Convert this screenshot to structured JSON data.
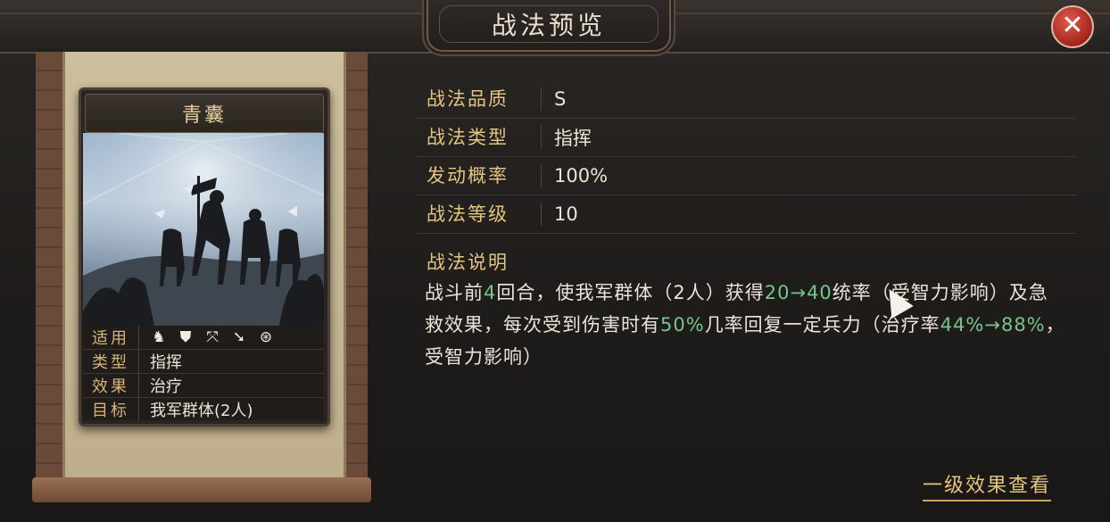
{
  "header": {
    "title": "战法预览",
    "close_glyph": "✕"
  },
  "card": {
    "name": "青囊",
    "rows": [
      {
        "key": "适用",
        "icons": [
          "cavalry-icon",
          "shield-icon",
          "bow-icon",
          "spear-icon",
          "wheel-icon"
        ]
      },
      {
        "key": "类型",
        "value": "指挥"
      },
      {
        "key": "效果",
        "value": "治疗"
      },
      {
        "key": "目标",
        "value": "我军群体(2人)"
      }
    ]
  },
  "info": [
    {
      "key": "战法品质",
      "value": "S"
    },
    {
      "key": "战法类型",
      "value": "指挥"
    },
    {
      "key": "发动概率",
      "value": "100%"
    },
    {
      "key": "战法等级",
      "value": "10"
    }
  ],
  "description": {
    "title": "战法说明",
    "segments": [
      {
        "t": "战斗前",
        "hl": false
      },
      {
        "t": "4",
        "hl": true
      },
      {
        "t": "回合，使我军群体（2人）获得",
        "hl": false
      },
      {
        "t": "20→40",
        "hl": true
      },
      {
        "t": "统率（受智力影响）及急救效果，每次受到伤害时有",
        "hl": false
      },
      {
        "t": "50%",
        "hl": true
      },
      {
        "t": "几率回复一定兵力（治疗率",
        "hl": false
      },
      {
        "t": "44%→88%",
        "hl": true
      },
      {
        "t": "，受智力影响）",
        "hl": false
      }
    ]
  },
  "footer": {
    "link_label": "一级效果查看"
  },
  "colors": {
    "highlight": "#78c48c",
    "label_gold": "#e5c482",
    "close_red": "#c0392b"
  }
}
